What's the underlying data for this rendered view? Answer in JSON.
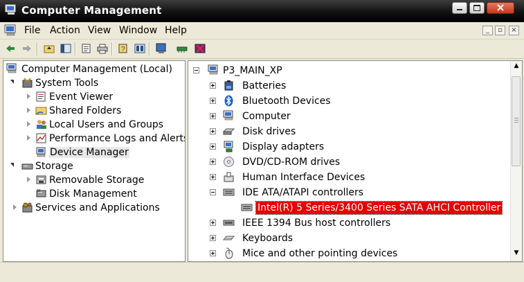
{
  "window": {
    "title": "Computer Management"
  },
  "menu": {
    "items": [
      "File",
      "Action",
      "View",
      "Window",
      "Help"
    ]
  },
  "toolbar": {
    "icons": [
      "back-icon",
      "forward-icon",
      "up-folder-icon",
      "show-hide-tree-icon",
      "properties-icon",
      "print-icon",
      "help-icon",
      "console-icon",
      "scan-hardware-icon",
      "update-driver-icon",
      "uninstall-icon"
    ]
  },
  "tree": {
    "root": "Computer Management (Local)",
    "system_tools": "System Tools",
    "event_viewer": "Event Viewer",
    "shared_folders": "Shared Folders",
    "local_users": "Local Users and Groups",
    "perf_logs": "Performance Logs and Alerts",
    "device_manager": "Device Manager",
    "storage": "Storage",
    "removable_storage": "Removable Storage",
    "disk_management": "Disk Management",
    "services": "Services and Applications"
  },
  "devices": {
    "computer_name": "P3_MAIN_XP",
    "batteries": "Batteries",
    "bluetooth": "Bluetooth Devices",
    "computer": "Computer",
    "disk_drives": "Disk drives",
    "display": "Display adapters",
    "dvd": "DVD/CD-ROM drives",
    "hid": "Human Interface Devices",
    "ide": "IDE ATA/ATAPI controllers",
    "sata": "Intel(R) 5 Series/3400 Series SATA AHCI Controller",
    "ieee": "IEEE 1394 Bus host controllers",
    "keyboards": "Keyboards",
    "mice": "Mice and other pointing devices"
  },
  "colors": {
    "selection": "#e60000",
    "titlebar": "#000000",
    "chrome": "#ece9d8"
  }
}
